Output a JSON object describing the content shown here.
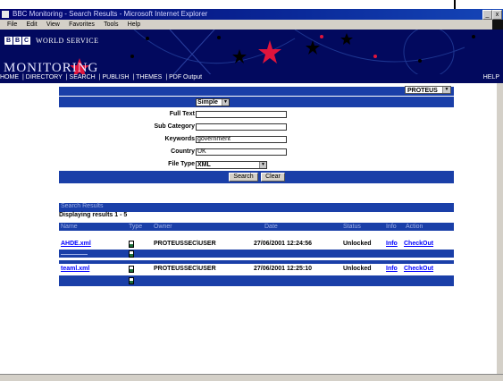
{
  "window": {
    "title": "BBC Monitoring - Search Results - Microsoft Internet Explorer",
    "controls": [
      "_",
      "x"
    ]
  },
  "menu": {
    "items": [
      "File",
      "Edit",
      "View",
      "Favorites",
      "Tools",
      "Help"
    ]
  },
  "banner": {
    "bbc": [
      "B",
      "B",
      "C"
    ],
    "world_service": "WORLD SERVICE",
    "monitoring": "MONITORING"
  },
  "nav": {
    "items": [
      "HOME",
      "DIRECTORY",
      "SEARCH",
      "PUBLISH",
      "THEMES",
      "PDF Output"
    ],
    "help": "HELP"
  },
  "header_row": {
    "login_value": "PROTEUS"
  },
  "form": {
    "type_value": "Simple",
    "fields": [
      {
        "label": "Full Text",
        "value": ""
      },
      {
        "label": "Sub Category",
        "value": ""
      },
      {
        "label": "Keywords",
        "value": "government"
      },
      {
        "label": "Country",
        "value": "UK"
      }
    ],
    "file_type_label": "File Type",
    "file_type_value": "XML",
    "search_button": "Search",
    "clear_button": "Clear"
  },
  "results": {
    "title": "Search Results",
    "display_text": "Displaying results 1 - 5",
    "columns": [
      "Name",
      "Type",
      "Owner",
      "Date",
      "Status",
      "Info",
      "Action"
    ],
    "rows": [
      {
        "name": "AHDE.xml",
        "owner": "PROTEUSSEC\\USER",
        "date": "27/06/2001 12:24:56",
        "status": "Unlocked",
        "info": "Info",
        "action": "CheckOut",
        "style": "white"
      },
      {
        "name": "",
        "owner": "",
        "date": "",
        "status": "",
        "info": "",
        "action": "",
        "style": "blue"
      },
      {
        "name": "teaml.xml",
        "owner": "PROTEUSSEC\\USER",
        "date": "27/06/2001 12:25:10",
        "status": "Unlocked",
        "info": "Info",
        "action": "CheckOut",
        "style": "white"
      },
      {
        "name": "",
        "owner": "",
        "date": "",
        "status": "",
        "info": "",
        "action": "",
        "style": "blue"
      }
    ]
  },
  "colors": {
    "banner": "#02095e",
    "bar_blue": "#1a3fa8",
    "link": "#0000ff",
    "star_red": "#e0143c"
  }
}
